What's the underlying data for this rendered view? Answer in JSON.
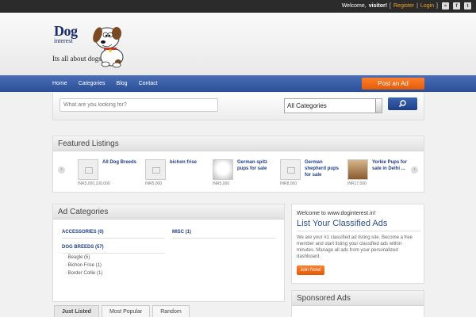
{
  "topbar": {
    "welcome": "Welcome,",
    "user": "visitor!",
    "register": "Register",
    "login": "Login",
    "social": [
      {
        "icon": "rss-icon",
        "glyph": "≈"
      },
      {
        "icon": "facebook-icon",
        "glyph": "f"
      },
      {
        "icon": "twitter-icon",
        "glyph": "t"
      }
    ]
  },
  "logo": {
    "word1": "Dog",
    "word2": "interest",
    "tagline": "Its all about dogs"
  },
  "nav": {
    "items": [
      "Home",
      "Categories",
      "Blog",
      "Contact"
    ],
    "post_ad": "Post an Ad"
  },
  "search": {
    "placeholder": "What are you looking for?",
    "category": "All Categories"
  },
  "featured": {
    "title": "Featured Listings",
    "items": [
      {
        "title": "All Dog Breeds",
        "price": "INR5,000,100,000",
        "thumb": "placeholder"
      },
      {
        "title": "bichon frise",
        "price": "INR5,000",
        "thumb": "placeholder"
      },
      {
        "title": "German spitz pups for sale",
        "price": "INR5,000",
        "thumb": "photo-white"
      },
      {
        "title": "German shepherd pups for sale",
        "price": "INR8,000",
        "thumb": "placeholder"
      },
      {
        "title": "Yorkie Pups for sale in Delhi ...",
        "price": "INR17,000",
        "thumb": "photo"
      }
    ]
  },
  "ad_categories": {
    "title": "Ad Categories",
    "col1_head": "ACCESSORIES (0)",
    "col1_head2": "DOG BREEDS (57)",
    "col1_subs": [
      "Beagle (5)",
      "Bichon Frise (1)",
      "Border Collie (1)"
    ],
    "col2_head": "MISC (1)"
  },
  "welcome": {
    "line1": "Welcome to www.doginterest.in!",
    "headline": "List Your Classified Ads",
    "body": "We are your #1 classified ad listing site. Become a free member and start listing your classified ads within minutes. Manage all ads from your personalized dashboard.",
    "join": "Join Now!"
  },
  "sponsored": {
    "title": "Sponsored Ads"
  },
  "tabs": [
    "Just Listed",
    "Most Popular",
    "Random"
  ],
  "colors": {
    "accent_orange": "#e25c08",
    "nav_blue": "#2c4f96",
    "link_blue": "#1f3f86"
  }
}
